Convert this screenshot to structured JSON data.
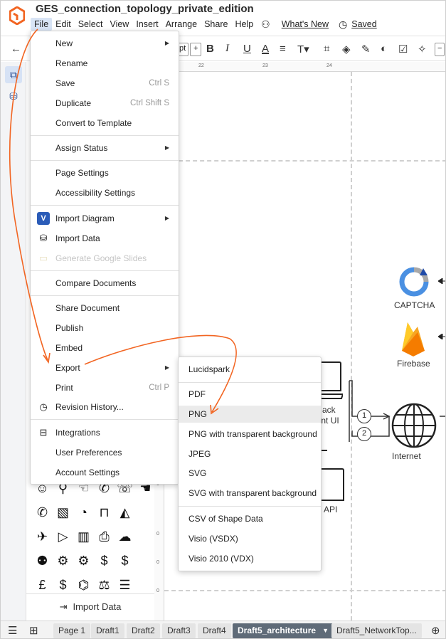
{
  "app": {
    "doc_title": "GES_connection_topology_private_edition",
    "menubar": [
      "File",
      "Edit",
      "Select",
      "View",
      "Insert",
      "Arrange",
      "Share",
      "Help"
    ],
    "whats_new": "What's New",
    "saved": "Saved"
  },
  "toolbar": {
    "font_size_unit": "pt"
  },
  "rulers": {
    "h": [
      "22",
      "23",
      "24"
    ],
    "v": [
      "0",
      "0",
      "0",
      "0"
    ]
  },
  "file_menu": {
    "items": [
      {
        "label": "New",
        "submenu": true
      },
      {
        "label": "Rename"
      },
      {
        "label": "Save",
        "shortcut": "Ctrl S"
      },
      {
        "label": "Duplicate",
        "shortcut": "Ctrl Shift S"
      },
      {
        "label": "Convert to Template"
      },
      {
        "label": "Assign Status",
        "submenu": true
      },
      {
        "label": "Page Settings"
      },
      {
        "label": "Accessibility Settings"
      },
      {
        "label": "Import Diagram",
        "submenu": true
      },
      {
        "label": "Import Data"
      },
      {
        "label": "Generate Google Slides",
        "disabled": true
      },
      {
        "label": "Compare Documents"
      },
      {
        "label": "Share Document"
      },
      {
        "label": "Publish"
      },
      {
        "label": "Embed"
      },
      {
        "label": "Export",
        "submenu": true
      },
      {
        "label": "Print",
        "shortcut": "Ctrl P"
      },
      {
        "label": "Revision History..."
      },
      {
        "label": "Integrations"
      },
      {
        "label": "User Preferences"
      },
      {
        "label": "Account Settings"
      }
    ]
  },
  "export_menu": {
    "items": [
      "Lucidspark",
      "PDF",
      "PNG",
      "PNG with transparent background",
      "JPEG",
      "SVG",
      "SVG with transparent background",
      "CSV of Shape Data",
      "Visio (VSDX)",
      "Visio 2010 (VDX)"
    ],
    "highlighted": "PNG"
  },
  "canvas": {
    "captcha": "CAPTCHA",
    "firebase": "Firebase",
    "node_partial_1": "ack",
    "node_partial_2": "nent UI",
    "api_partial": "API",
    "internet": "Internet",
    "badge_1": "1",
    "badge_2": "2"
  },
  "shapes_panel": {
    "import_data": "Import Data"
  },
  "tabs": [
    "Page 1",
    "Draft1",
    "Draft2",
    "Draft3",
    "Draft4",
    "Draft5_architecture",
    "Draft5_NetworkTop..."
  ],
  "active_tab": "Draft5_architecture",
  "colors": {
    "accent_orange": "#f26522",
    "highlight": "#ebebeb",
    "active_tab": "#5f6b78"
  }
}
